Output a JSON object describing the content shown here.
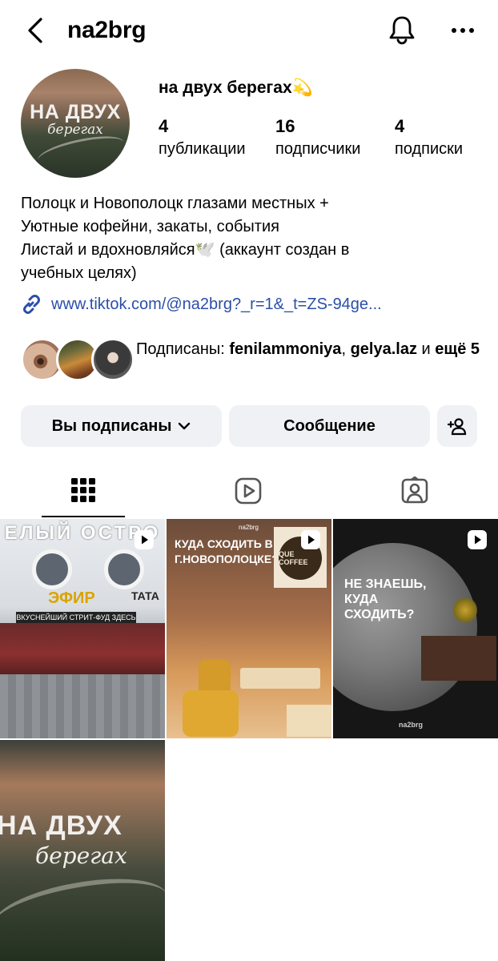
{
  "header": {
    "username": "na2brg"
  },
  "profile": {
    "full_name": "на двух берегах💫",
    "avatar_title_line1": "НА ДВУХ",
    "avatar_title_line2": "берегах",
    "stats": {
      "posts_count": "4",
      "posts_label": "публикации",
      "followers_count": "16",
      "followers_label": "подписчики",
      "following_count": "4",
      "following_label": "подписки"
    },
    "bio_lines": [
      "Полоцк и Новополоцк глазами местных +",
      "Уютные кофейни, закаты, события",
      "Листай и вдохновляйся🕊️  (аккаунт создан в",
      "учебных целях)"
    ],
    "link": "www.tiktok.com/@na2brg?_r=1&_t=ZS-94ge..."
  },
  "mutuals": {
    "prefix": "Подписаны: ",
    "user1": "fenilammoniya",
    "separator": ", ",
    "user2": "gelya.laz",
    "middle": " и ",
    "more": "ещё 5"
  },
  "actions": {
    "following_label": "Вы подписаны",
    "message_label": "Сообщение"
  },
  "posts": {
    "post1": {
      "sign": "ЕЛЫЙ ОСТРО",
      "efir": "ЭФИР",
      "tata": "ТАТА",
      "banner": "ВКУСНЕЙШИЙ СТРИТ-ФУД ЗДЕСЬ"
    },
    "post2": {
      "tag": "na2brg",
      "title": "КУДА СХОДИТЬ В Г.НОВОПОЛОЦКЕ?",
      "logo": "QUE COFFEE"
    },
    "post3": {
      "title_line1": "НЕ ЗНАЕШЬ,",
      "title_line2": "КУДА",
      "title_line3": "СХОДИТЬ?",
      "tag": "na2brg"
    },
    "post4": {
      "title_line1": "НА ДВУХ",
      "title_line2": "берегах"
    }
  },
  "icons": {
    "back": "chevron-left-icon",
    "bell": "bell-icon",
    "more": "more-horizontal-icon",
    "link": "link-icon",
    "add_user": "add-user-icon",
    "grid": "grid-icon",
    "reels": "reels-icon",
    "tagged": "tagged-person-icon"
  }
}
